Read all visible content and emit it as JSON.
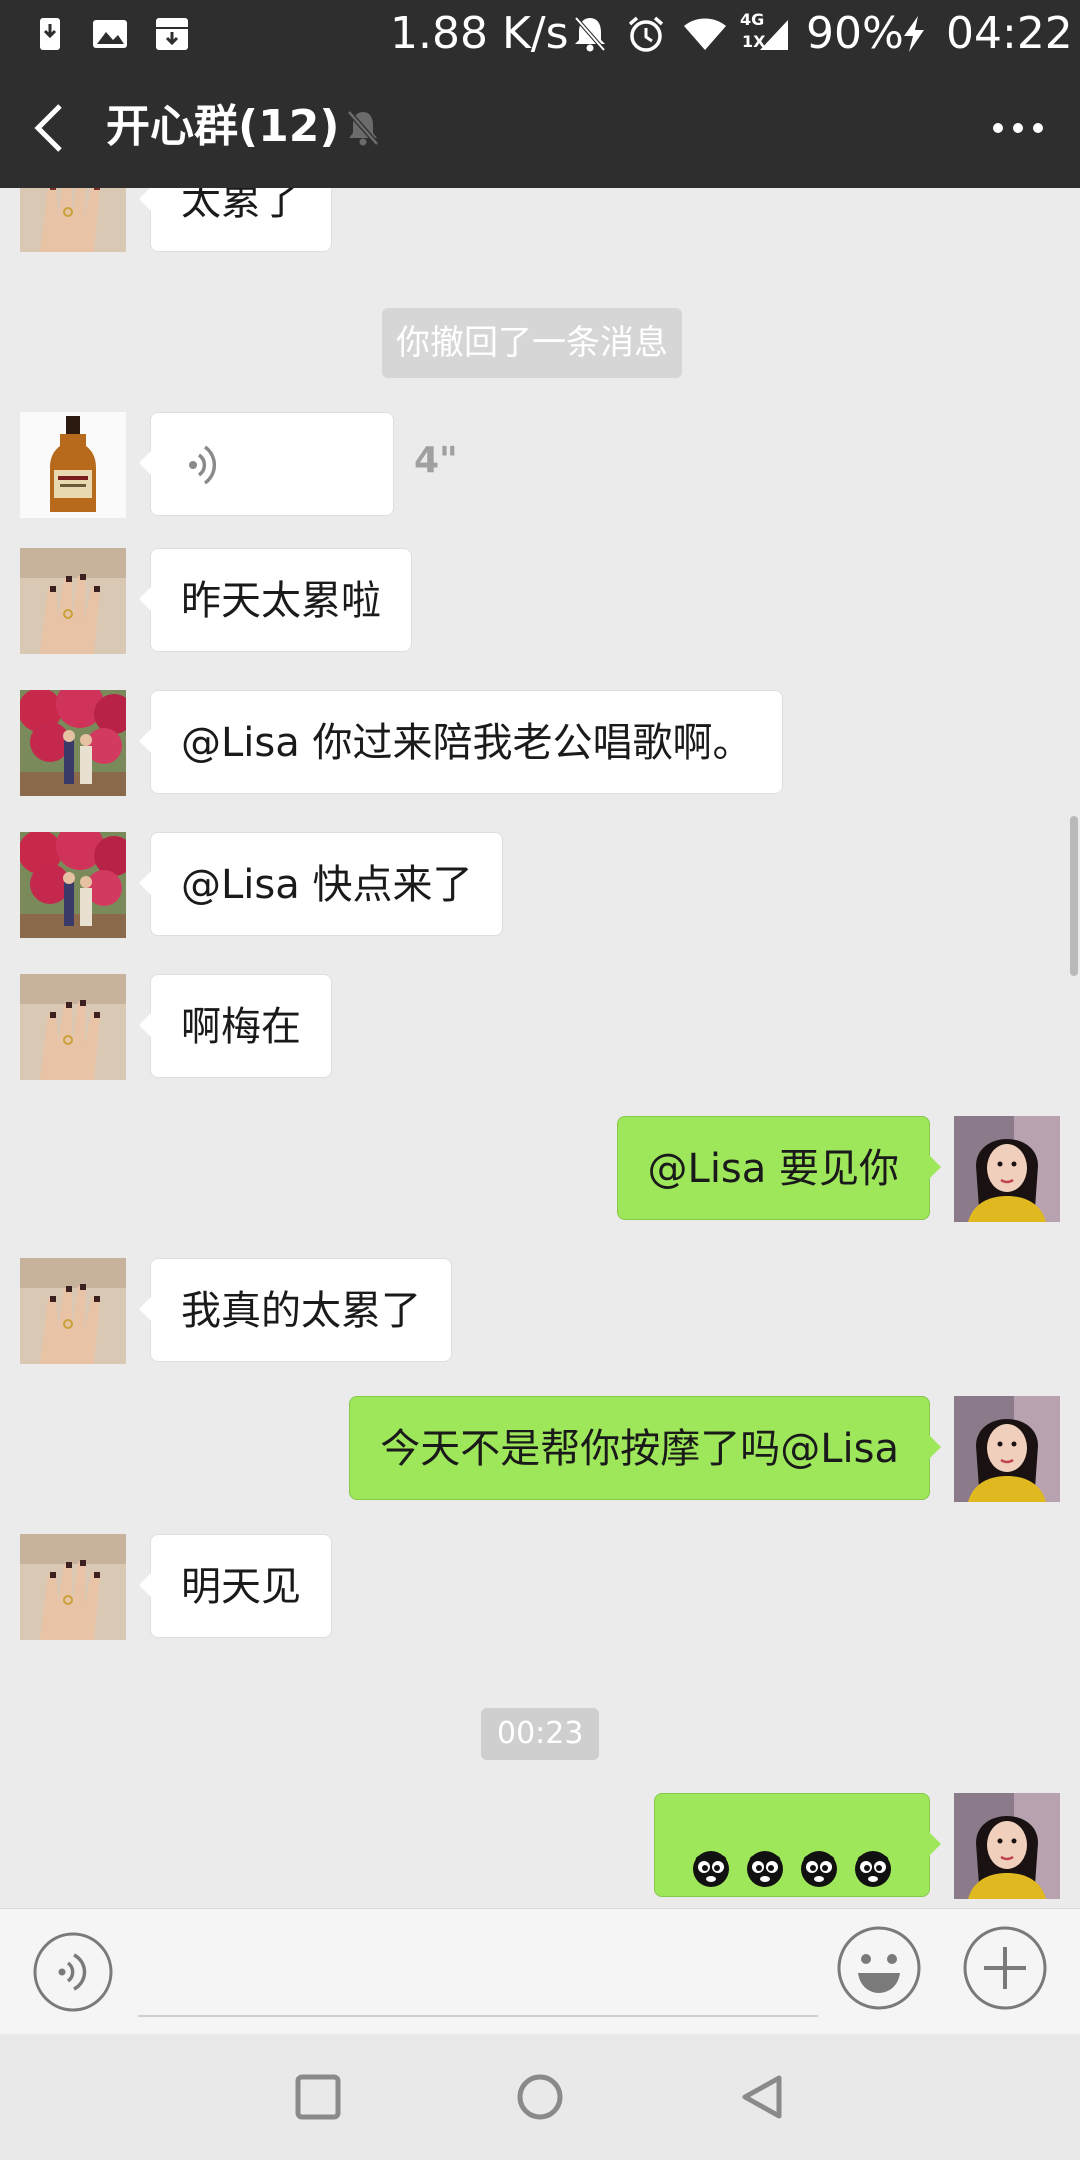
{
  "status_bar": {
    "network_speed": "1.88 K/s",
    "network_type_top": "4G",
    "network_type_bottom": "1X",
    "battery": "90%",
    "time": "04:22"
  },
  "header": {
    "title": "开心群(12)"
  },
  "messages": [
    {
      "side": "left",
      "avatar": "hand-avatar",
      "text": "太累了"
    },
    {
      "type": "system",
      "text": "你撤回了一条消息"
    },
    {
      "side": "left",
      "avatar": "bottle-avatar",
      "type": "voice",
      "duration": "4\""
    },
    {
      "side": "left",
      "avatar": "hand-avatar",
      "text": "昨天太累啦"
    },
    {
      "side": "left",
      "avatar": "flowers-avatar",
      "text": "@Lisa  你过来陪我老公唱歌啊。"
    },
    {
      "side": "left",
      "avatar": "flowers-avatar",
      "text": "@Lisa  快点来了"
    },
    {
      "side": "left",
      "avatar": "hand-avatar",
      "text": "啊梅在"
    },
    {
      "side": "right",
      "avatar": "woman-avatar",
      "text": "@Lisa  要见你"
    },
    {
      "side": "left",
      "avatar": "hand-avatar",
      "text": "我真的太累了"
    },
    {
      "side": "right",
      "avatar": "woman-avatar",
      "text": "今天不是帮你按摩了吗@Lisa"
    },
    {
      "side": "left",
      "avatar": "hand-avatar",
      "text": "明天见"
    },
    {
      "type": "timestamp",
      "text": "00:23"
    },
    {
      "side": "right",
      "avatar": "woman-avatar",
      "type": "stickers",
      "count": 4
    }
  ],
  "colors": {
    "title_bar": "#2e2e2e",
    "chat_background": "#ebebeb",
    "bubble_sent": "#9ee75a",
    "bubble_received": "#ffffff"
  },
  "icons": {
    "back": "back-chevron-icon",
    "mute": "bell-muted-icon",
    "more": "more-dots-icon",
    "voice_toggle": "voice-mode-icon",
    "emoji": "emoji-icon",
    "plus": "plus-icon"
  }
}
